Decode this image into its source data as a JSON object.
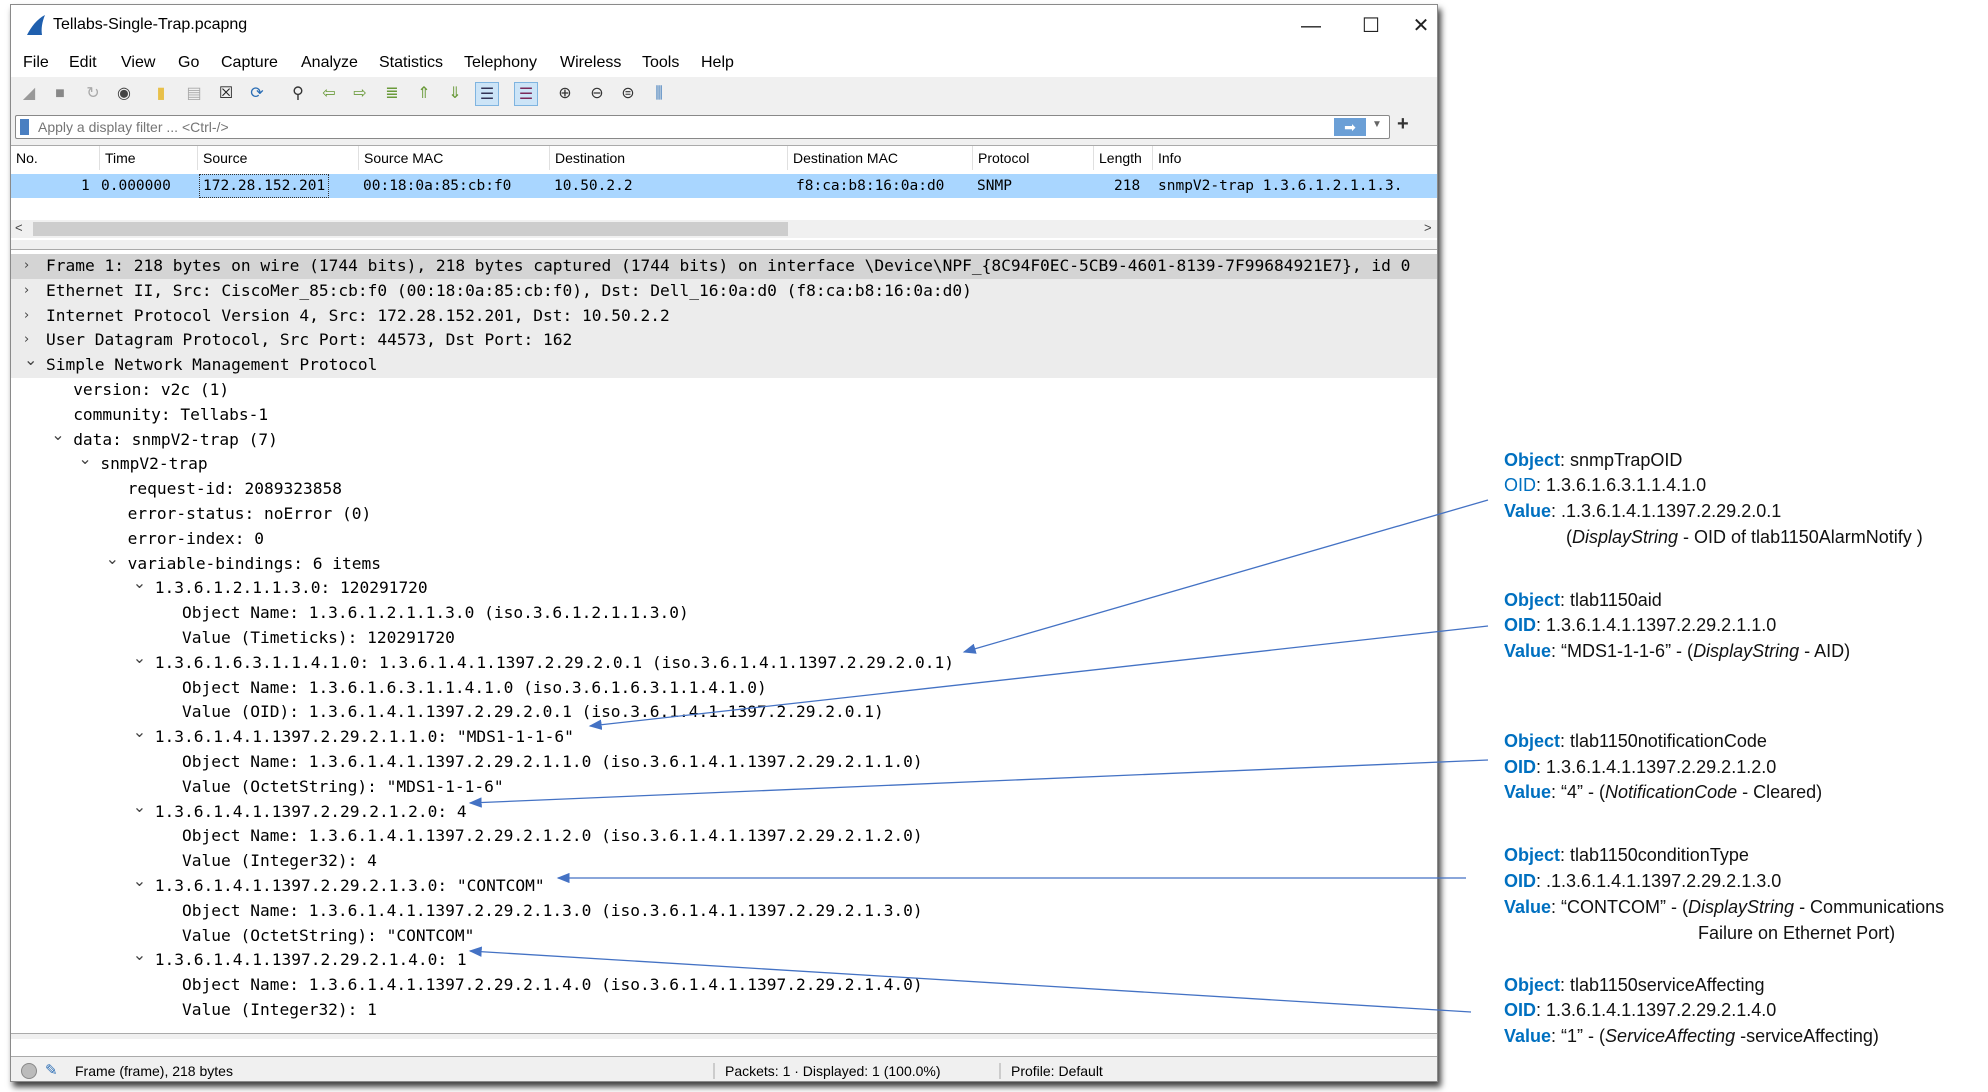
{
  "window": {
    "title": "Tellabs-Single-Trap.pcapng",
    "controls": [
      "—",
      "☐",
      "✕"
    ]
  },
  "menu": [
    "File",
    "Edit",
    "View",
    "Go",
    "Capture",
    "Analyze",
    "Statistics",
    "Telephony",
    "Wireless",
    "Tools",
    "Help"
  ],
  "toolbar": [
    "start-capture",
    "stop-capture",
    "restart-capture",
    "capture-options",
    "open-file",
    "save-file",
    "close-file",
    "reload-file",
    "find-packet",
    "go-back",
    "go-forward",
    "go-to-packet",
    "first-packet",
    "last-packet",
    "auto-scroll",
    "colorize",
    "zoom-in",
    "zoom-out",
    "normal-size",
    "resize-columns"
  ],
  "filter": {
    "placeholder": "Apply a display filter ... <Ctrl-/>",
    "apply": "➡",
    "add": "+"
  },
  "packet_list": {
    "columns": [
      "No.",
      "Time",
      "Source",
      "Source MAC",
      "Destination",
      "Destination MAC",
      "Protocol",
      "Length",
      "Info"
    ],
    "rows": [
      [
        "1",
        "0.000000",
        "172.28.152.201",
        "00:18:0a:85:cb:f0",
        "10.50.2.2",
        "f8:ca:b8:16:0a:d0",
        "SNMP",
        "218",
        "snmpV2-trap 1.3.6.1.2.1.1.3."
      ]
    ]
  },
  "details": [
    {
      "level": 0,
      "exp": "closed",
      "text": "Frame 1: 218 bytes on wire (1744 bits), 218 bytes captured (1744 bits) on interface \\Device\\NPF_{8C94F0EC-5CB9-4601-8139-7F99684921E7}, id 0"
    },
    {
      "level": 0,
      "exp": "closed",
      "text": "Ethernet II, Src: CiscoMer_85:cb:f0 (00:18:0a:85:cb:f0), Dst: Dell_16:0a:d0 (f8:ca:b8:16:0a:d0)"
    },
    {
      "level": 0,
      "exp": "closed",
      "text": "Internet Protocol Version 4, Src: 172.28.152.201, Dst: 10.50.2.2"
    },
    {
      "level": 0,
      "exp": "closed",
      "text": "User Datagram Protocol, Src Port: 44573, Dst Port: 162"
    },
    {
      "level": 0,
      "exp": "open",
      "text": "Simple Network Management Protocol"
    },
    {
      "level": 1,
      "exp": "",
      "text": "version: v2c (1)"
    },
    {
      "level": 1,
      "exp": "",
      "text": "community: Tellabs-1"
    },
    {
      "level": 1,
      "exp": "open",
      "text": "data: snmpV2-trap (7)"
    },
    {
      "level": 2,
      "exp": "open",
      "text": "snmpV2-trap"
    },
    {
      "level": 3,
      "exp": "",
      "text": "request-id: 2089323858"
    },
    {
      "level": 3,
      "exp": "",
      "text": "error-status: noError (0)"
    },
    {
      "level": 3,
      "exp": "",
      "text": "error-index: 0"
    },
    {
      "level": 3,
      "exp": "open",
      "text": "variable-bindings: 6 items"
    },
    {
      "level": 4,
      "exp": "open",
      "text": "1.3.6.1.2.1.1.3.0: 120291720"
    },
    {
      "level": 5,
      "exp": "",
      "text": "Object Name: 1.3.6.1.2.1.1.3.0 (iso.3.6.1.2.1.1.3.0)"
    },
    {
      "level": 5,
      "exp": "",
      "text": "Value (Timeticks): 120291720"
    },
    {
      "level": 4,
      "exp": "open",
      "text": "1.3.6.1.6.3.1.1.4.1.0: 1.3.6.1.4.1.1397.2.29.2.0.1 (iso.3.6.1.4.1.1397.2.29.2.0.1)"
    },
    {
      "level": 5,
      "exp": "",
      "text": "Object Name: 1.3.6.1.6.3.1.1.4.1.0 (iso.3.6.1.6.3.1.1.4.1.0)"
    },
    {
      "level": 5,
      "exp": "",
      "text": "Value (OID): 1.3.6.1.4.1.1397.2.29.2.0.1 (iso.3.6.1.4.1.1397.2.29.2.0.1)"
    },
    {
      "level": 4,
      "exp": "open",
      "text": "1.3.6.1.4.1.1397.2.29.2.1.1.0: \"MDS1-1-1-6\""
    },
    {
      "level": 5,
      "exp": "",
      "text": "Object Name: 1.3.6.1.4.1.1397.2.29.2.1.1.0 (iso.3.6.1.4.1.1397.2.29.2.1.1.0)"
    },
    {
      "level": 5,
      "exp": "",
      "text": "Value (OctetString): \"MDS1-1-1-6\""
    },
    {
      "level": 4,
      "exp": "open",
      "text": "1.3.6.1.4.1.1397.2.29.2.1.2.0: 4"
    },
    {
      "level": 5,
      "exp": "",
      "text": "Object Name: 1.3.6.1.4.1.1397.2.29.2.1.2.0 (iso.3.6.1.4.1.1397.2.29.2.1.2.0)"
    },
    {
      "level": 5,
      "exp": "",
      "text": "Value (Integer32): 4"
    },
    {
      "level": 4,
      "exp": "open",
      "text": "1.3.6.1.4.1.1397.2.29.2.1.3.0: \"CONTCOM\""
    },
    {
      "level": 5,
      "exp": "",
      "text": "Object Name: 1.3.6.1.4.1.1397.2.29.2.1.3.0 (iso.3.6.1.4.1.1397.2.29.2.1.3.0)"
    },
    {
      "level": 5,
      "exp": "",
      "text": "Value (OctetString): \"CONTCOM\""
    },
    {
      "level": 4,
      "exp": "open",
      "text": "1.3.6.1.4.1.1397.2.29.2.1.4.0: 1"
    },
    {
      "level": 5,
      "exp": "",
      "text": "Object Name: 1.3.6.1.4.1.1397.2.29.2.1.4.0 (iso.3.6.1.4.1.1397.2.29.2.1.4.0)"
    },
    {
      "level": 5,
      "exp": "",
      "text": "Value (Integer32): 1"
    }
  ],
  "status": {
    "frame": "Frame (frame), 218 bytes",
    "packets": "Packets: 1 · Displayed: 1 (100.0%)",
    "profile": "Profile: Default"
  },
  "annotations": {
    "labels": {
      "object": "Object",
      "oid": "OID",
      "value": "Value"
    },
    "items": [
      {
        "object": "snmpTrapOID",
        "oid": "1.3.6.1.6.3.1.1.4.1.0",
        "value": ".1.3.6.1.4.1.1397.2.29.2.0.1",
        "type": "DisplayString",
        "desc": " - OID of  tlab1150AlarmNotify )"
      },
      {
        "object": "tlab1150aid",
        "oid": "1.3.6.1.4.1.1397.2.29.2.1.1.0",
        "value": "“MDS1-1-1-6” - (",
        "type": "DisplayString",
        "desc": " -  AID)"
      },
      {
        "object": "tlab1150notificationCode",
        "oid": "1.3.6.1.4.1.1397.2.29.2.1.2.0",
        "value": "“4” - (",
        "type": "NotificationCode",
        "desc": " - Cleared)"
      },
      {
        "object": "tlab1150conditionType",
        "oid": ".1.3.6.1.4.1.1397.2.29.2.1.3.0",
        "value": "“CONTCOM” - (",
        "type": "DisplayString",
        "desc": " - Communications",
        "desc2": "Failure on Ethernet Port)"
      },
      {
        "object": "tlab1150serviceAffecting",
        "oid": "1.3.6.1.4.1.1397.2.29.2.1.4.0",
        "value": "“1” - (",
        "type": "ServiceAffecting",
        "desc": " -serviceAffecting)"
      }
    ],
    "open_paren": "(",
    "arrow_color": "#4472c4",
    "label_color": "#0070c0"
  }
}
